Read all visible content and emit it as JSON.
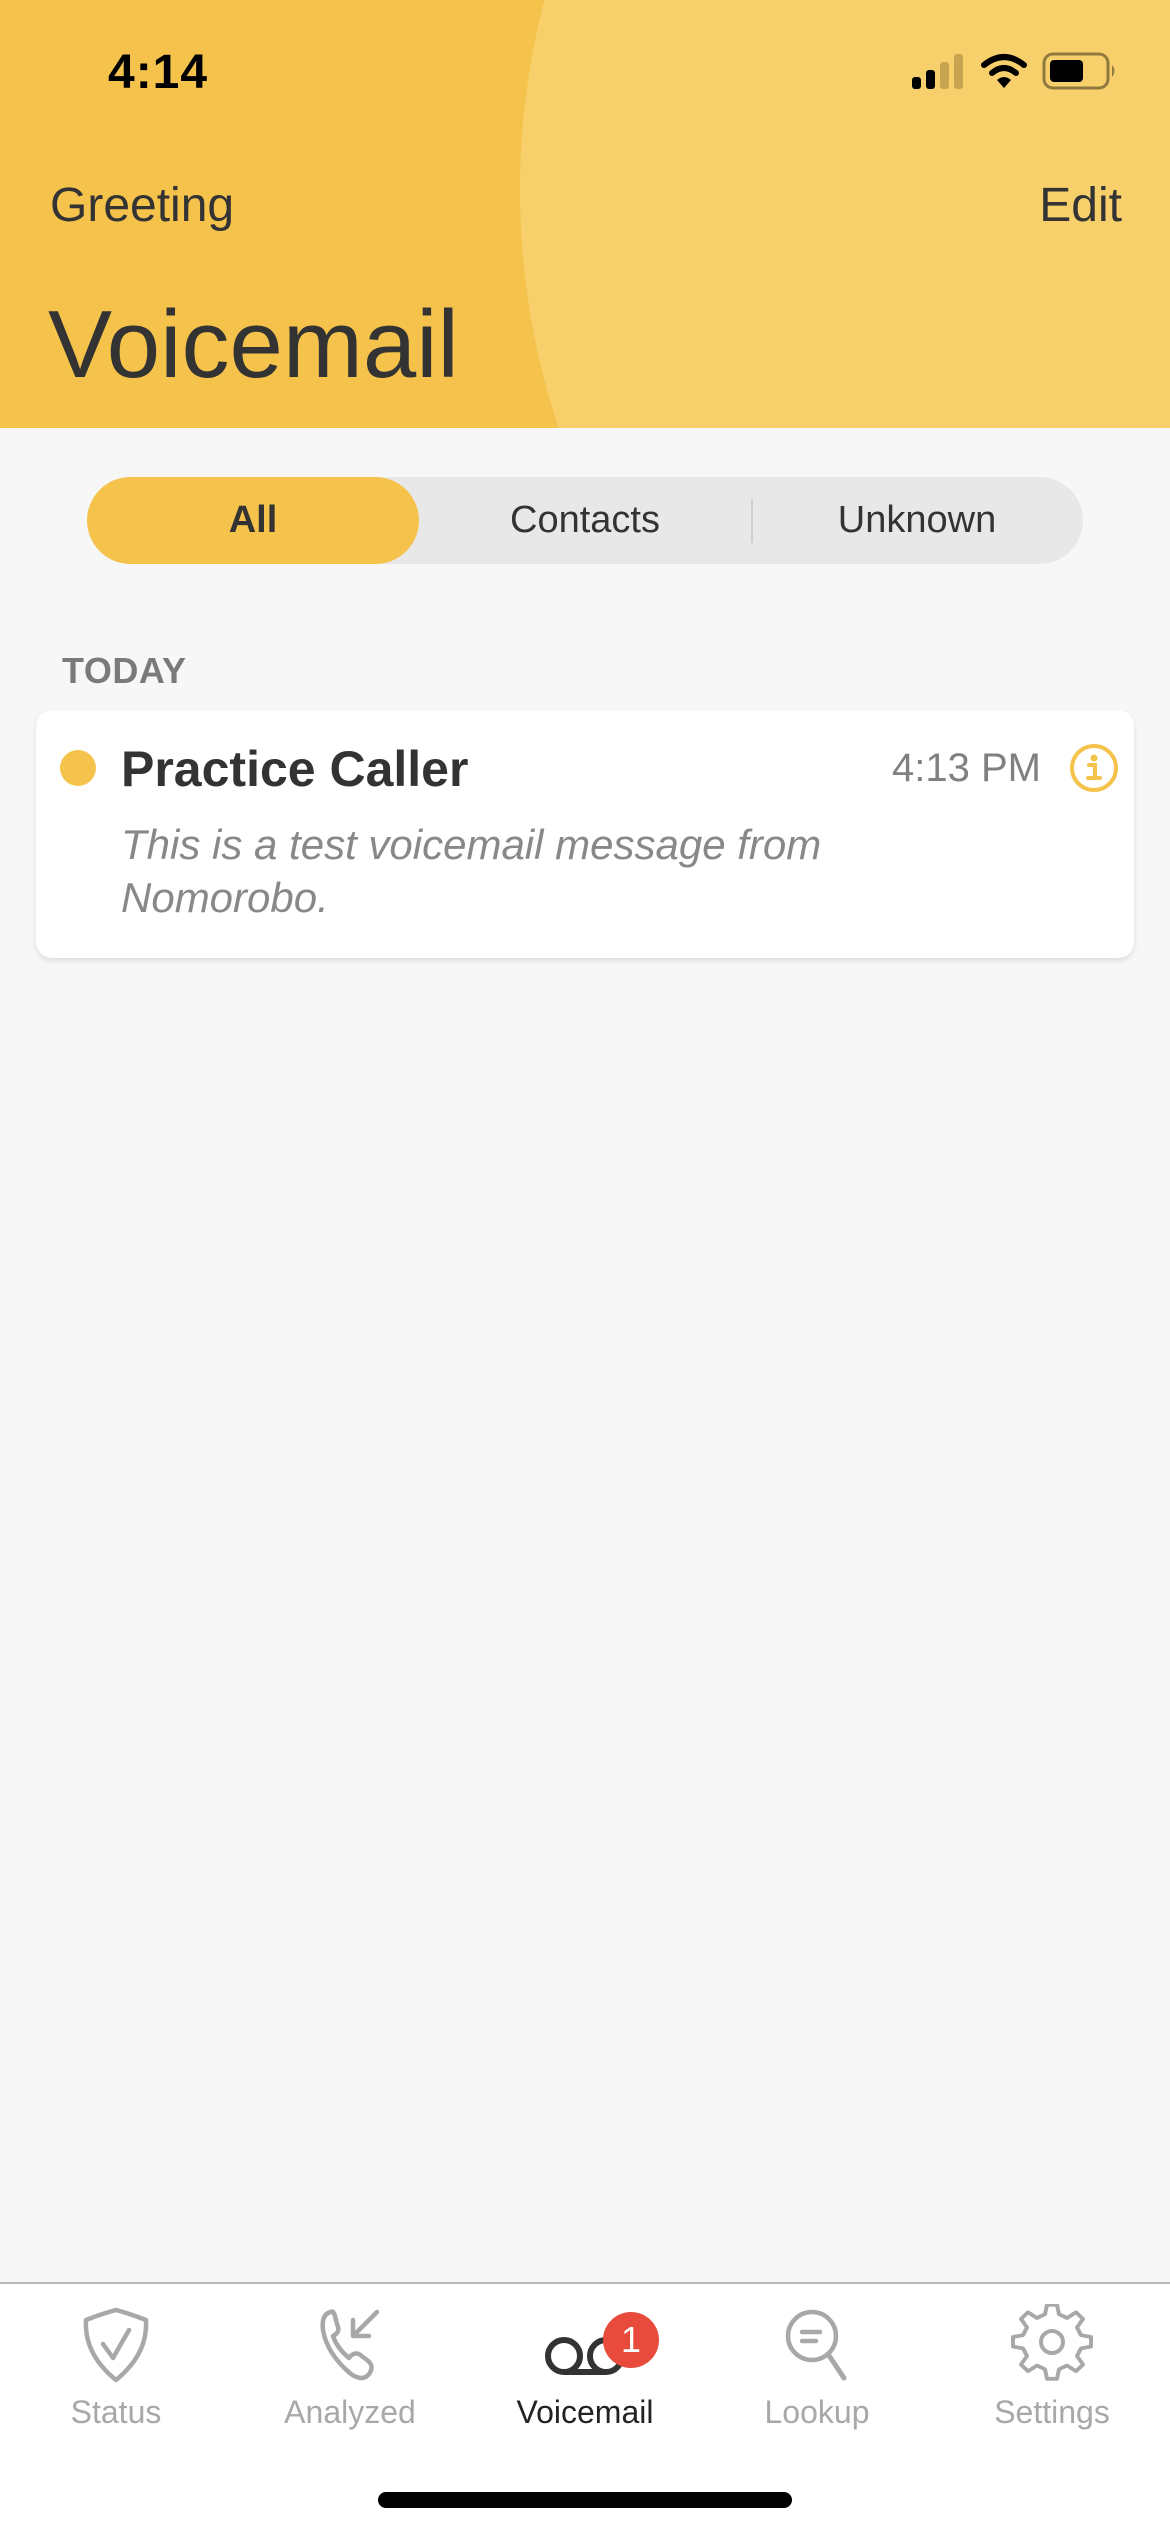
{
  "status_bar": {
    "time": "4:14",
    "signal_bars_active": 2,
    "signal_bars_total": 4,
    "battery_level": 0.55
  },
  "nav": {
    "left_label": "Greeting",
    "right_label": "Edit",
    "title": "Voicemail"
  },
  "filter": {
    "segments": [
      {
        "label": "All",
        "selected": true
      },
      {
        "label": "Contacts",
        "selected": false
      },
      {
        "label": "Unknown",
        "selected": false
      }
    ]
  },
  "sections": [
    {
      "label": "TODAY",
      "items": [
        {
          "caller": "Practice Caller",
          "time": "4:13 PM",
          "unread": true,
          "transcript": "This is a test voicemail message from Nomorobo.",
          "info_icon": "info-icon"
        }
      ]
    }
  ],
  "tabbar": {
    "tabs": [
      {
        "label": "Status",
        "icon": "shield-check-icon",
        "active": false
      },
      {
        "label": "Analyzed",
        "icon": "incoming-call-icon",
        "active": false
      },
      {
        "label": "Voicemail",
        "icon": "voicemail-icon",
        "active": true,
        "badge": "1"
      },
      {
        "label": "Lookup",
        "icon": "search-icon",
        "active": false
      },
      {
        "label": "Settings",
        "icon": "gear-icon",
        "active": false
      }
    ]
  },
  "colors": {
    "accent": "#f5c34c",
    "accent_light": "#f7d06c",
    "badge": "#e84b3c",
    "text_primary": "#333333",
    "text_secondary": "#888888",
    "tab_inactive": "#a8a8a8"
  }
}
